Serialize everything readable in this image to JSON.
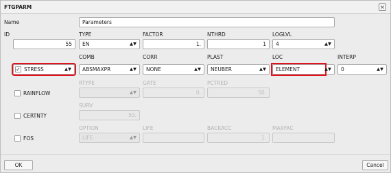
{
  "window": {
    "title": "FTGPARM",
    "close_icon": "close-icon"
  },
  "name": {
    "label": "Name",
    "value": "Parameters"
  },
  "row1": {
    "labels": {
      "id": "ID",
      "type": "TYPE",
      "factor": "FACTOR",
      "nthrd": "NTHRD",
      "loglvl": "LOGLVL"
    },
    "id_value": "55",
    "type_value": "EN",
    "factor_value": "1.",
    "nthrd_value": "1",
    "loglvl_value": "4"
  },
  "row2": {
    "labels": {
      "comb": "COMB",
      "corr": "CORR",
      "plast": "PLAST",
      "loc": "LOC",
      "interp": "INTERP"
    },
    "stress_checked": true,
    "stress_label": "STRESS",
    "comb_value": "ABSMAXPR",
    "corr_value": "NONE",
    "plast_value": "NEUBER",
    "loc_value": "ELEMENT",
    "interp_value": "0"
  },
  "rainflow": {
    "labels": {
      "rtype": "RTYPE",
      "gate": "GATE",
      "pctred": "PCTRED"
    },
    "checked": false,
    "label": "RAINFLOW",
    "rtype_value": "",
    "gate_value": "0.",
    "pctred_value": "50."
  },
  "certnty": {
    "labels": {
      "surv": "SURV"
    },
    "checked": false,
    "label": "CERTNTY",
    "surv_value": "50."
  },
  "fos": {
    "labels": {
      "option": "OPTION",
      "life": "LIFE",
      "backacc": "BACKACC",
      "maxfac": "MAXFAC"
    },
    "checked": false,
    "label": "FOS",
    "option_value": "LIFE",
    "life_value": "",
    "backacc_value": "1.",
    "maxfac_value": ""
  },
  "buttons": {
    "ok": "OK",
    "cancel": "Cancel"
  },
  "highlight_color": "#e0141e"
}
